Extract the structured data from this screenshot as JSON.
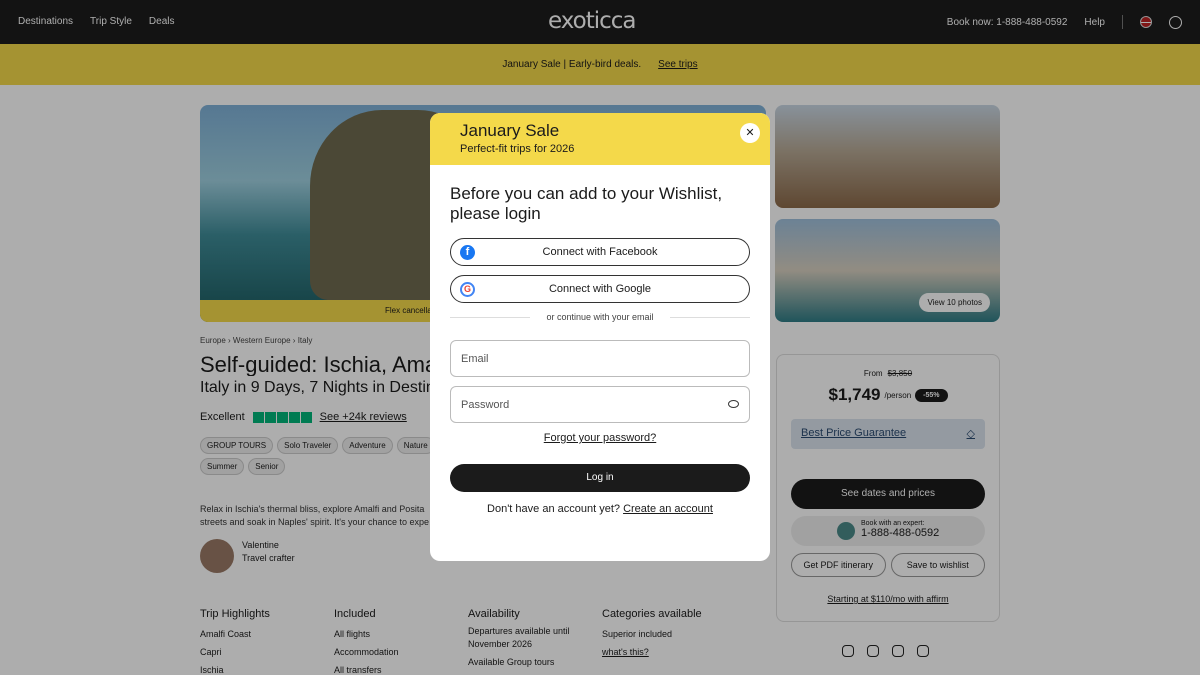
{
  "nav": {
    "links": [
      "Destinations",
      "Trip Style",
      "Deals"
    ],
    "logo": "exoticca",
    "phone": "Book now: 1-888-488-0592",
    "help": "Help"
  },
  "banner": {
    "text": "January Sale | Early-bird deals.",
    "link": "See trips"
  },
  "hero": {
    "caption": "Flex cancella",
    "view_photos": "View 10 photos"
  },
  "breadcrumb": [
    "Europe",
    "Western Europe",
    "Italy"
  ],
  "trip": {
    "title": "Self-guided: Ischia, Amalfi",
    "subtitle": "Italy in 9 Days, 7 Nights in Destina",
    "rating_label": "Excellent",
    "reviews": "See +24k reviews",
    "tags": [
      "GROUP TOURS",
      "Solo Traveler",
      "Adventure",
      "Nature",
      "Summer",
      "Senior"
    ],
    "desc1": "Relax in Ischia's thermal bliss, explore Amalfi and Posita",
    "desc2": "streets and soak in Naples' spirit. It's your chance to expe",
    "crafter_name": "Valentine",
    "crafter_role": "Travel crafter"
  },
  "highlights": {
    "title": "Trip Highlights",
    "items": [
      "Amalfi Coast",
      "Capri",
      "Ischia"
    ]
  },
  "included": {
    "title": "Included",
    "items": [
      "All flights",
      "Accommodation",
      "All transfers"
    ]
  },
  "availability": {
    "title": "Availability",
    "line1": "Departures available until",
    "line2": "November 2026",
    "line3": "Available Group tours"
  },
  "categories": {
    "title": "Categories available",
    "line1": "Superior included",
    "link": "what's this?"
  },
  "price": {
    "from": "From",
    "old": "$3,850",
    "value": "$1,749",
    "per": "/person",
    "discount": "-55%",
    "guarantee": "Best Price Guarantee",
    "cta": "See dates and prices",
    "expert_label": "Book with an expert:",
    "expert_phone": "1-888-488-0592",
    "pdf": "Get PDF itinerary",
    "wishlist": "Save to wishlist",
    "affirm": "Starting at $110/mo with affirm"
  },
  "modal": {
    "head_title": "January Sale",
    "head_sub": "Perfect-fit trips for 2026",
    "close": "✕",
    "title": "Before you can add to your Wishlist, please login",
    "facebook": "Connect with Facebook",
    "google": "Connect with Google",
    "or": "or continue with your email",
    "email_ph": "Email",
    "password_ph": "Password",
    "forgot": "Forgot your password?",
    "login": "Log in",
    "no_account": "Don't have an account yet?",
    "create": "Create an account"
  }
}
